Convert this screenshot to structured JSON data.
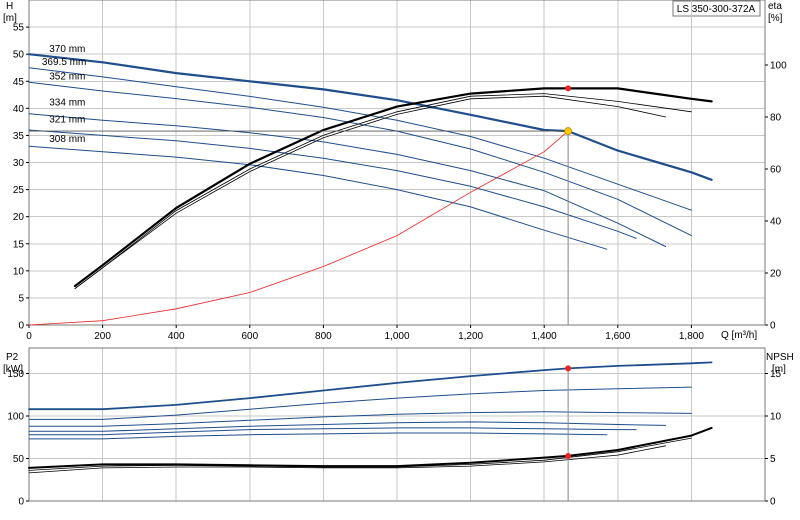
{
  "model_label": "LS 350-300-372A",
  "colors": {
    "blue": "#1f4e8c",
    "black": "#000000",
    "red": "#ee2222",
    "duty": "#ffcc00",
    "grid": "#c8c8c8"
  },
  "chart_data": [
    {
      "id": "head",
      "type": "line",
      "ylabel_top": "H",
      "ylabel_unit": "[m]",
      "ylabel2_top": "eta",
      "ylabel2_unit": "[%]",
      "xlabel": "Q [m³/h]",
      "xlim": [
        0,
        2000
      ],
      "ylim": [
        0,
        60
      ],
      "y2lim": [
        0,
        125
      ],
      "x_ticks": [
        0,
        200,
        400,
        600,
        800,
        1000,
        1200,
        1400,
        1600,
        1800
      ],
      "x_tick_labels": [
        "0",
        "200",
        "400",
        "600",
        "800",
        "1,000",
        "1,200",
        "1,400",
        "1,600",
        "1,800"
      ],
      "y_ticks": [
        0,
        5,
        10,
        15,
        20,
        25,
        30,
        35,
        40,
        45,
        50,
        55
      ],
      "y_tick_labels": [
        "0",
        "5",
        "10",
        "15",
        "20",
        "25",
        "30",
        "35",
        "40",
        "45",
        "50",
        "55"
      ],
      "y2_ticks": [
        0,
        20,
        40,
        60,
        80,
        100
      ],
      "y2_tick_labels": [
        "0",
        "20",
        "40",
        "60",
        "80",
        "100"
      ],
      "grid": true,
      "series": [
        {
          "name": "370 mm",
          "axis": "left",
          "color": "#1f4e8c",
          "width": 2.2,
          "x": [
            0,
            200,
            400,
            600,
            800,
            1000,
            1200,
            1400,
            1465,
            1600,
            1800,
            1855
          ],
          "y": [
            50,
            48.5,
            46.5,
            45.0,
            43.5,
            41.5,
            38.8,
            36.0,
            35.8,
            32.2,
            28.2,
            26.8
          ]
        },
        {
          "name": "369.5 mm",
          "axis": "left",
          "color": "#1f4e8c",
          "width": 1,
          "x": [
            0,
            200,
            400,
            600,
            800,
            1000,
            1200,
            1400,
            1600,
            1800
          ],
          "y": [
            47.5,
            45.8,
            44.0,
            42.2,
            40.2,
            37.8,
            34.8,
            30.8,
            26.0,
            21.2
          ]
        },
        {
          "name": "352 mm",
          "axis": "left",
          "color": "#1f4e8c",
          "width": 1,
          "x": [
            0,
            200,
            400,
            600,
            800,
            1000,
            1200,
            1400,
            1600,
            1800
          ],
          "y": [
            44.8,
            43.2,
            41.8,
            40.2,
            38.3,
            35.8,
            32.5,
            28.2,
            23.2,
            16.5
          ]
        },
        {
          "name": "334 mm",
          "axis": "left",
          "color": "#1f4e8c",
          "width": 1,
          "x": [
            0,
            200,
            400,
            600,
            800,
            1000,
            1200,
            1400,
            1600,
            1730
          ],
          "y": [
            39.0,
            37.8,
            36.8,
            35.5,
            33.8,
            31.5,
            28.5,
            24.8,
            18.8,
            14.5
          ]
        },
        {
          "name": "321 mm",
          "axis": "left",
          "color": "#1f4e8c",
          "width": 1,
          "x": [
            0,
            200,
            400,
            600,
            800,
            1000,
            1200,
            1400,
            1600,
            1650
          ],
          "y": [
            36.0,
            35.0,
            34.0,
            32.6,
            30.8,
            28.5,
            25.6,
            21.8,
            17.3,
            16.0
          ]
        },
        {
          "name": "308 mm",
          "axis": "left",
          "color": "#1f4e8c",
          "width": 1,
          "x": [
            0,
            200,
            400,
            600,
            800,
            1000,
            1200,
            1400,
            1570
          ],
          "y": [
            33.0,
            32.0,
            31.0,
            29.6,
            27.6,
            25.0,
            21.8,
            17.5,
            14.0
          ]
        },
        {
          "name": "",
          "axis": "left",
          "color": "#ee2222",
          "width": 0.8,
          "x": [
            0,
            200,
            400,
            600,
            800,
            1000,
            1200,
            1400,
            1465
          ],
          "y": [
            0,
            0.8,
            3.0,
            6.0,
            10.8,
            16.5,
            24.5,
            32.0,
            35.8
          ]
        },
        {
          "name": "",
          "axis": "right",
          "color": "#000000",
          "width": 2.2,
          "x": [
            125,
            200,
            400,
            600,
            800,
            1000,
            1200,
            1400,
            1600,
            1700,
            1800,
            1855
          ],
          "y": [
            15,
            23,
            45,
            62,
            75,
            84,
            89,
            91,
            91,
            89,
            87,
            86
          ]
        },
        {
          "name": "",
          "axis": "right",
          "color": "#000000",
          "width": 0.8,
          "x": [
            125,
            200,
            400,
            600,
            800,
            1000,
            1200,
            1400,
            1600,
            1800
          ],
          "y": [
            14,
            22,
            44,
            60,
            73,
            82,
            88,
            89,
            86,
            82
          ]
        },
        {
          "name": "",
          "axis": "right",
          "color": "#000000",
          "width": 0.8,
          "x": [
            125,
            200,
            400,
            600,
            800,
            1000,
            1200,
            1400,
            1600,
            1730
          ],
          "y": [
            14,
            22,
            43,
            59,
            72,
            81,
            87,
            88,
            84,
            80
          ]
        }
      ],
      "curve_labels": [
        {
          "text": "370 mm",
          "x": 55,
          "y": 50
        },
        {
          "text": "369.5 mm",
          "x": 35,
          "y": 47.6
        },
        {
          "text": "352 mm",
          "x": 55,
          "y": 45.0
        },
        {
          "text": "334 mm",
          "x": 55,
          "y": 40.2
        },
        {
          "text": "321 mm",
          "x": 55,
          "y": 37.0
        },
        {
          "text": "308 mm",
          "x": 55,
          "y": 33.4
        }
      ],
      "duty_point": {
        "x": 1465,
        "y": 35.8
      },
      "efficiency_point": {
        "x": 1465,
        "y2": 91
      }
    },
    {
      "id": "power",
      "type": "line",
      "ylabel_top": "P2",
      "ylabel_unit": "[kW]",
      "ylabel2_top": "NPSH",
      "ylabel2_unit": "[m]",
      "xlim": [
        0,
        2000
      ],
      "ylim": [
        0,
        180
      ],
      "y2lim": [
        0,
        18
      ],
      "y_ticks": [
        0,
        50,
        100,
        150
      ],
      "y_tick_labels": [
        "0",
        "50",
        "100",
        "150"
      ],
      "y2_ticks": [
        0,
        5,
        10,
        15
      ],
      "y2_tick_labels": [
        "0",
        "5",
        "10",
        "15"
      ],
      "grid": true,
      "series": [
        {
          "name": "",
          "axis": "left",
          "color": "#1f4e8c",
          "width": 1.8,
          "x": [
            0,
            200,
            400,
            600,
            800,
            1000,
            1200,
            1400,
            1465,
            1600,
            1800,
            1855
          ],
          "y": [
            108,
            108,
            113,
            121,
            130,
            139,
            147,
            154,
            156,
            159,
            162,
            163
          ]
        },
        {
          "name": "",
          "axis": "left",
          "color": "#1f4e8c",
          "width": 1,
          "x": [
            0,
            200,
            400,
            600,
            800,
            1000,
            1200,
            1400,
            1600,
            1800
          ],
          "y": [
            96,
            96,
            101,
            108,
            115,
            121,
            126,
            130,
            132,
            134
          ]
        },
        {
          "name": "",
          "axis": "left",
          "color": "#1f4e8c",
          "width": 1,
          "x": [
            0,
            200,
            400,
            600,
            800,
            1000,
            1200,
            1400,
            1600,
            1800
          ],
          "y": [
            88,
            88,
            91,
            95,
            99,
            102,
            104,
            105,
            104,
            103
          ]
        },
        {
          "name": "",
          "axis": "left",
          "color": "#1f4e8c",
          "width": 1,
          "x": [
            0,
            200,
            400,
            600,
            800,
            1000,
            1200,
            1400,
            1600,
            1730
          ],
          "y": [
            82,
            82,
            85,
            88,
            90,
            92,
            93,
            92,
            90,
            89
          ]
        },
        {
          "name": "",
          "axis": "left",
          "color": "#1f4e8c",
          "width": 1,
          "x": [
            0,
            200,
            400,
            600,
            800,
            1000,
            1200,
            1400,
            1600,
            1650
          ],
          "y": [
            78,
            78,
            81,
            84,
            85,
            86,
            86,
            85,
            84,
            84
          ]
        },
        {
          "name": "",
          "axis": "left",
          "color": "#1f4e8c",
          "width": 1,
          "x": [
            0,
            200,
            400,
            600,
            800,
            1000,
            1200,
            1400,
            1570
          ],
          "y": [
            73,
            73,
            76,
            78,
            79,
            80,
            80,
            79,
            78
          ]
        },
        {
          "name": "",
          "axis": "right",
          "color": "#000000",
          "width": 2,
          "x": [
            0,
            200,
            400,
            600,
            800,
            1000,
            1200,
            1400,
            1465,
            1600,
            1800,
            1855
          ],
          "y": [
            3.9,
            4.3,
            4.3,
            4.2,
            4.1,
            4.1,
            4.5,
            5.1,
            5.3,
            6.0,
            7.7,
            8.6
          ]
        },
        {
          "name": "",
          "axis": "right",
          "color": "#000000",
          "width": 0.8,
          "x": [
            0,
            200,
            400,
            600,
            800,
            1000,
            1200,
            1400,
            1600,
            1800
          ],
          "y": [
            3.6,
            4.1,
            4.2,
            4.1,
            4.0,
            4.0,
            4.3,
            4.8,
            5.8,
            7.4
          ]
        },
        {
          "name": "",
          "axis": "right",
          "color": "#000000",
          "width": 0.8,
          "x": [
            0,
            200,
            400,
            600,
            800,
            1000,
            1200,
            1400,
            1600,
            1730
          ],
          "y": [
            3.3,
            3.9,
            4.0,
            4.0,
            3.9,
            3.9,
            4.1,
            4.6,
            5.4,
            6.5
          ]
        }
      ],
      "power_point": {
        "x": 1465,
        "y": 156
      },
      "npsh_point": {
        "x": 1465,
        "y2": 5.3
      }
    }
  ]
}
